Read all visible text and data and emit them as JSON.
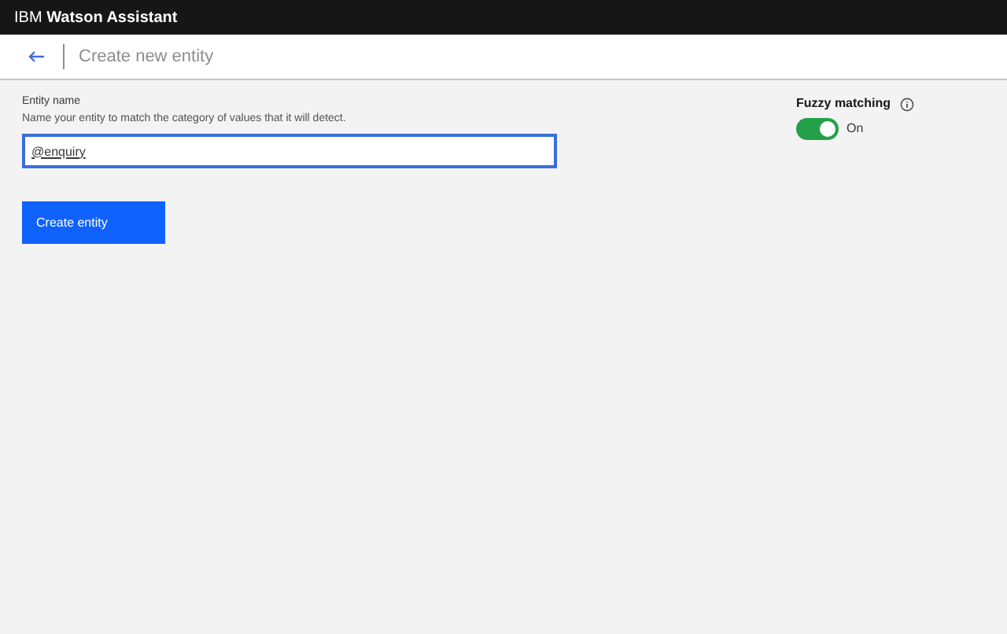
{
  "header": {
    "title": "IBM **Watson Assistant**"
  },
  "page": {
    "title": "Create new entity"
  },
  "entity_name": {
    "label": "Entity name",
    "help": "Name your entity to match the category of values that it will detect.",
    "value": "@enquiry"
  },
  "fuzzy_matching": {
    "label": "Fuzzy matching",
    "on": true,
    "state_text": "On"
  },
  "create_button": {
    "label": "Create entity"
  }
}
